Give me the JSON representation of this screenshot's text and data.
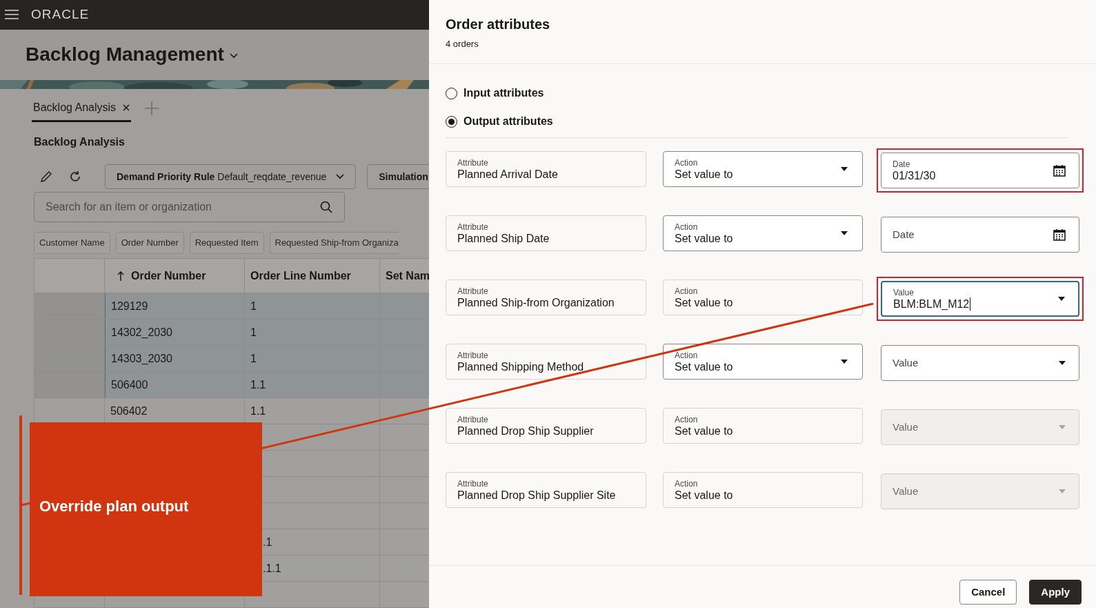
{
  "app_bar": {
    "logo": "ORACLE"
  },
  "page": {
    "title": "Backlog Management",
    "tabs": [
      {
        "label": "Backlog Analysis",
        "selected": true
      }
    ],
    "section_title": "Backlog Analysis",
    "toolbar": {
      "rule_label": "Demand Priority Rule",
      "rule_value": "Default_reqdate_revenue",
      "simulation": "Simulation"
    },
    "search": {
      "placeholder": "Search for an item or organization"
    },
    "filter_chips": [
      "Customer Name",
      "Order Number",
      "Requested Item",
      "Requested Ship-from Organiza"
    ],
    "table": {
      "columns": [
        {
          "label": "Order Number",
          "sorted": true
        },
        {
          "label": "Order Line Number",
          "sorted": false
        },
        {
          "label": "Set Nam",
          "sorted": false
        }
      ],
      "rows": [
        {
          "order_number": "129129",
          "line_number": "1",
          "selected": true
        },
        {
          "order_number": "14302_2030",
          "line_number": "1",
          "selected": true
        },
        {
          "order_number": "14303_2030",
          "line_number": "1",
          "selected": true
        },
        {
          "order_number": "506400",
          "line_number": "1.1",
          "selected": true
        },
        {
          "order_number": "506402",
          "line_number": "1.1",
          "selected": false
        },
        {
          "selected": false
        },
        {
          "selected": false
        },
        {
          "selected": false
        },
        {
          "selected": false
        },
        {
          "line_number": ".1",
          "selected": false
        },
        {
          "line_number": ".1.1",
          "selected": false
        },
        {
          "selected": false
        }
      ]
    }
  },
  "drawer": {
    "title": "Order attributes",
    "subtitle": "4 orders",
    "modes": [
      {
        "label": "Input attributes",
        "selected": false
      },
      {
        "label": "Output attributes",
        "selected": true
      }
    ],
    "rows": [
      {
        "attribute_label": "Attribute",
        "attribute": "Planned Arrival Date",
        "action_label": "Action",
        "action": "Set value to",
        "action_dropdown": true,
        "kind": "date",
        "value_label": "Date",
        "value": "01/31/30",
        "highlighted": true,
        "focused": false,
        "disabled": false
      },
      {
        "attribute_label": "Attribute",
        "attribute": "Planned Ship Date",
        "action_label": "Action",
        "action": "Set value to",
        "action_dropdown": true,
        "kind": "date",
        "value_label": "Date",
        "highlighted": false,
        "focused": false,
        "disabled": false
      },
      {
        "attribute_label": "Attribute",
        "attribute": "Planned Ship-from Organization",
        "action_label": "Action",
        "action": "Set value to",
        "action_dropdown": false,
        "kind": "select",
        "value_label": "Value",
        "value": "BLM:BLM_M12",
        "highlighted": true,
        "focused": true,
        "disabled": false
      },
      {
        "attribute_label": "Attribute",
        "attribute": "Planned Shipping Method",
        "action_label": "Action",
        "action": "Set value to",
        "action_dropdown": true,
        "kind": "select",
        "value_label": "Value",
        "highlighted": false,
        "focused": false,
        "disabled": false
      },
      {
        "attribute_label": "Attribute",
        "attribute": "Planned Drop Ship Supplier",
        "action_label": "Action",
        "action": "Set value to",
        "action_dropdown": false,
        "kind": "select",
        "value_label": "Value",
        "highlighted": false,
        "focused": false,
        "disabled": true
      },
      {
        "attribute_label": "Attribute",
        "attribute": "Planned Drop Ship Supplier Site",
        "action_label": "Action",
        "action": "Set value to",
        "action_dropdown": false,
        "kind": "select",
        "value_label": "Value",
        "highlighted": false,
        "focused": false,
        "disabled": true
      }
    ],
    "buttons": [
      {
        "label": "Cancel",
        "kind": "secondary"
      },
      {
        "label": "Apply",
        "kind": "primary"
      }
    ]
  },
  "callout": {
    "text": "Override plan output"
  }
}
